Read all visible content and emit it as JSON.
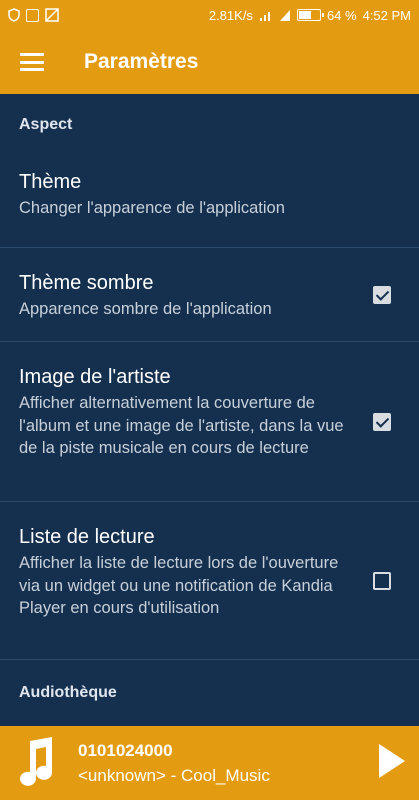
{
  "status_bar": {
    "speed": "2.81K/s",
    "battery_text": "64 %",
    "battery_level": 0.64,
    "time": "4:52 PM",
    "icons": [
      "shield-icon",
      "sim-icon",
      "signal-off-icon",
      "wifi-icon",
      "cellular-signal-icon",
      "battery-icon"
    ]
  },
  "app_bar": {
    "title": "Paramètres",
    "menu_icon": "hamburger-menu-icon"
  },
  "sections": [
    {
      "header": "Aspect"
    },
    {
      "header": "Audiothèque"
    }
  ],
  "settings": [
    {
      "title": "Thème",
      "summary": "Changer l'apparence de l'application",
      "has_checkbox": false
    },
    {
      "title": "Thème sombre",
      "summary": "Apparence sombre de l'application",
      "has_checkbox": true,
      "checked": true
    },
    {
      "title": "Image de l'artiste",
      "summary": "Afficher alternativement la couverture de l'album et une image de l'artiste, dans la vue de la piste musicale en cours de lecture",
      "has_checkbox": true,
      "checked": true
    },
    {
      "title": "Liste de lecture",
      "summary": "Afficher la liste de lecture lors de l'ouverture via un widget ou une notification de Kandia Player en cours d'utilisation",
      "has_checkbox": true,
      "checked": false
    }
  ],
  "player": {
    "track_title": "0101024000",
    "track_subtitle": "<unknown> - Cool_Music",
    "icon": "music-note-icon",
    "play_icon": "play-icon"
  },
  "colors": {
    "accent": "#e39c12",
    "background": "#15304f",
    "divider": "#2b4a6b"
  }
}
